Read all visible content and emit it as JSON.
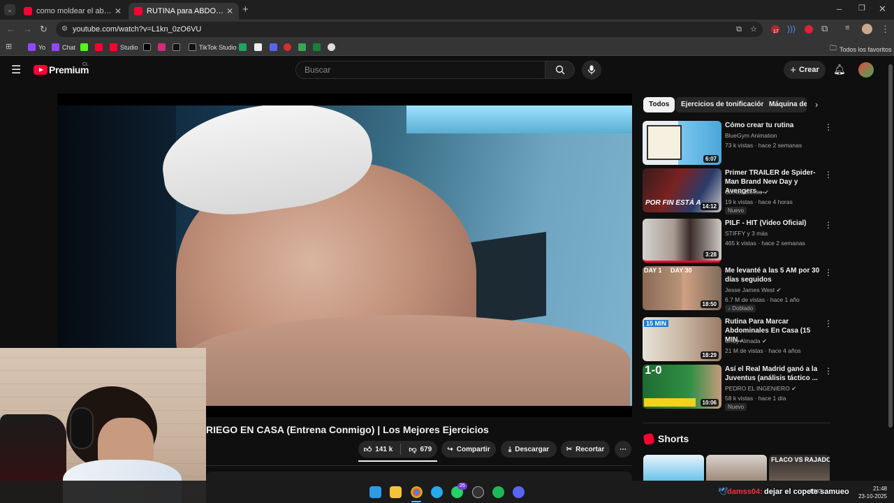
{
  "browser": {
    "tabs": [
      {
        "title": "como moldear el abdomen en"
      },
      {
        "title": "RUTINA para ABDOMEN de D..."
      }
    ],
    "new_tab": "+",
    "url": "youtube.com/watch?v=L1kn_0zO6VU",
    "bookmarks": [
      "Yo",
      "Chat",
      "Studio",
      "TikTok Studio"
    ],
    "all_bookmarks": "Todos los favoritos",
    "extension_badge": "17"
  },
  "youtube": {
    "logo_text": "Premium",
    "logo_region": "CL",
    "search_placeholder": "Buscar",
    "create_label": "Crear"
  },
  "video": {
    "title": "RIEGO EN CASA (Entrena Conmigo) | Los Mejores Ejercicios",
    "likes": "141 k",
    "dislikes": "679",
    "share": "Compartir",
    "download": "Descargar",
    "clip": "Recortar"
  },
  "chips": [
    "Todos",
    "Ejercicios de tonificación",
    "Máquina de"
  ],
  "recommendations": [
    {
      "title": "Cómo crear tu rutina",
      "channel": "BlueGym Animation",
      "meta": "73 k vistas · hace 2 semanas",
      "duration": "6:07",
      "badge": "",
      "thumb_text": ""
    },
    {
      "title": "Primer TRAILER de Spider-Man Brand New Day y Avengers ...",
      "channel": "Somos Geeks",
      "meta": "19 k vistas · hace 4 horas",
      "duration": "14:12",
      "badge": "Nuevo",
      "thumb_text": "POR FIN ESTÁ A..."
    },
    {
      "title": "PILF - HIT (Video Oficial)",
      "channel": "STIFFY y 3 más",
      "meta": "465 k vistas · hace 2 semanas",
      "duration": "3:28",
      "badge": "",
      "thumb_text": ""
    },
    {
      "title": "Me levanté a las 5 AM por 30 días seguidos",
      "channel": "Jesse James West",
      "meta": "6.7 M de vistas · hace 1 año",
      "duration": "18:50",
      "badge": "Doblado",
      "thumb_text": "DAY 1     DAY 30"
    },
    {
      "title": "Rutina Para Marcar Abdominales En Casa (15 MIN...",
      "channel": "Chuy Almada",
      "meta": "21 M de vistas · hace 4 años",
      "duration": "18:29",
      "badge": "",
      "thumb_text": "15 MIN"
    },
    {
      "title": "Así el Real Madrid ganó a la Juventus (análisis táctico ...",
      "channel": "PEDRO EL INGENIERO",
      "meta": "58 k vistas · hace 1 día",
      "duration": "10:06",
      "badge": "Nuevo",
      "thumb_text": "1-0"
    }
  ],
  "shorts": {
    "label": "Shorts",
    "third_caption": "FLACO VS RAJADO"
  },
  "overlay": {
    "chat_user": "damss04:",
    "chat_text": "dejar el copete samueo"
  },
  "taskbar": {
    "lang": "ENG",
    "time": "21:48",
    "date": "23-10-2025",
    "badge": "25"
  }
}
